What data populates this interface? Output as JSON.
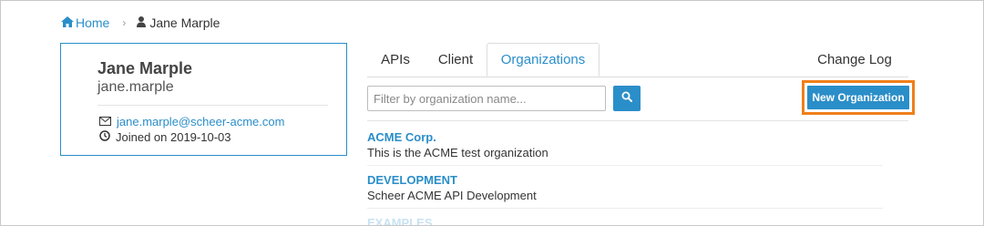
{
  "breadcrumb": {
    "home_label": "Home",
    "current_label": "Jane Marple"
  },
  "profile": {
    "name": "Jane Marple",
    "username": "jane.marple",
    "email": "jane.marple@scheer-acme.com",
    "joined": "Joined on 2019-10-03"
  },
  "tabs": [
    {
      "label": "APIs",
      "active": false
    },
    {
      "label": "Client",
      "active": false
    },
    {
      "label": "Organizations",
      "active": true
    },
    {
      "label": "Change Log",
      "active": false
    }
  ],
  "filter": {
    "placeholder": "Filter by organization name...",
    "value": ""
  },
  "new_org_button": "New Organization",
  "organizations": [
    {
      "name": "ACME Corp.",
      "description": "This is the ACME test organization"
    },
    {
      "name": "DEVELOPMENT",
      "description": "Scheer ACME API Development"
    },
    {
      "name": "EXAMPLES",
      "description": ""
    }
  ],
  "colors": {
    "accent": "#2a8ec9",
    "highlight": "#f07f1a"
  }
}
